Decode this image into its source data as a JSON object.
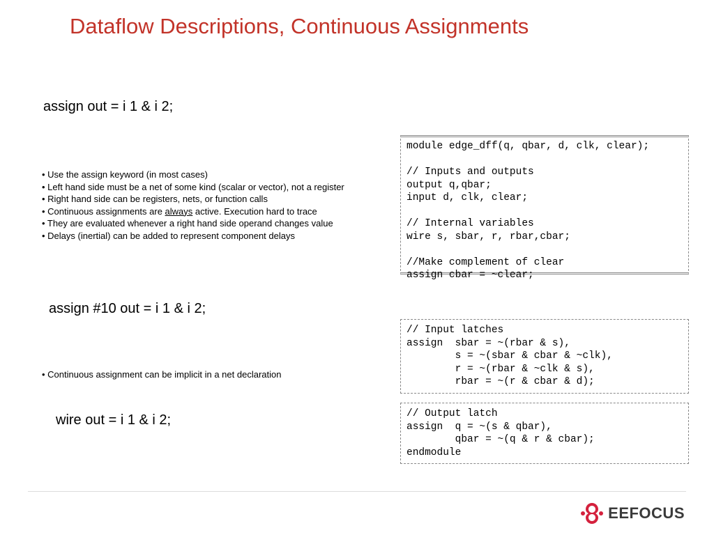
{
  "title": "Dataflow Descriptions, Continuous Assignments",
  "assign1": "assign out = i 1 & i 2;",
  "bullets1": {
    "b1": "• Use the assign keyword (in most cases)",
    "b2": "• Left hand side must be a net of some kind (scalar or vector), not a register",
    "b3": "• Right hand side can be registers, nets, or function calls",
    "b4_pre": "• Continuous assignments are ",
    "b4_u": "always",
    "b4_post": " active. Execution hard to trace",
    "b5": "• They are evaluated whenever a right hand side operand changes value",
    "b6": "• Delays (inertial) can be added to represent component delays"
  },
  "assign2": "assign #10 out = i 1 & i 2;",
  "bullets2": {
    "b1": "• Continuous assignment can be implicit in a net declaration"
  },
  "assign3": "wire out = i 1 & i 2;",
  "code1": "module edge_dff(q, qbar, d, clk, clear);\n\n// Inputs and outputs\noutput q,qbar;\ninput d, clk, clear;\n\n// Internal variables\nwire s, sbar, r, rbar,cbar;\n\n//Make complement of clear\nassign cbar = ~clear;",
  "code2": "// Input latches\nassign  sbar = ~(rbar & s),\n        s = ~(sbar & cbar & ~clk),\n        r = ~(rbar & ~clk & s),\n        rbar = ~(r & cbar & d);",
  "code3": "// Output latch\nassign  q = ~(s & qbar),\n        qbar = ~(q & r & cbar);\nendmodule",
  "logo": {
    "text": "EEFOCUS"
  }
}
